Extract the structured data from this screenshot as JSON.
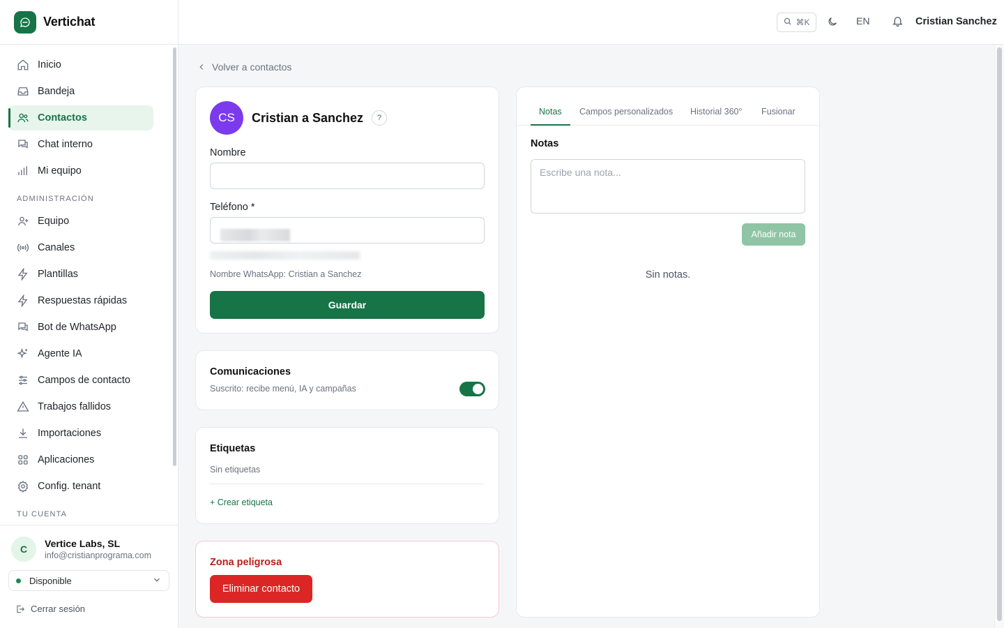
{
  "app": {
    "name": "Vertichat",
    "brand_color": "#167447"
  },
  "sidebar": {
    "items": [
      {
        "label": "Inicio",
        "icon": "home-icon",
        "active": false
      },
      {
        "label": "Bandeja",
        "icon": "inbox-icon",
        "active": false
      },
      {
        "label": "Contactos",
        "icon": "users-icon",
        "active": true
      },
      {
        "label": "Chat interno",
        "icon": "chat-icon",
        "active": false
      },
      {
        "label": "Mi equipo",
        "icon": "bar-chart-icon",
        "active": false
      }
    ],
    "admin_section": "ADMINISTRACIÓN",
    "admin_items": [
      {
        "label": "Equipo",
        "icon": "user-plus-icon"
      },
      {
        "label": "Canales",
        "icon": "radio-icon"
      },
      {
        "label": "Plantillas",
        "icon": "bolt-icon"
      },
      {
        "label": "Respuestas rápidas",
        "icon": "bolt-icon"
      },
      {
        "label": "Bot de WhatsApp",
        "icon": "chat-bot-icon"
      },
      {
        "label": "Agente IA",
        "icon": "sparkles-icon"
      },
      {
        "label": "Campos de contacto",
        "icon": "sliders-icon"
      },
      {
        "label": "Trabajos fallidos",
        "icon": "warning-icon"
      },
      {
        "label": "Importaciones",
        "icon": "download-icon"
      },
      {
        "label": "Aplicaciones",
        "icon": "apps-grid-icon"
      },
      {
        "label": "Config. tenant",
        "icon": "gear-icon"
      }
    ],
    "account_section": "TU CUENTA",
    "account": {
      "initial": "C",
      "org": "Vertice Labs, SL",
      "email": "info@cristianprograma.com"
    },
    "status": "Disponible",
    "logout": "Cerrar sesión"
  },
  "topbar": {
    "search_shortcut": "⌘K",
    "language": "EN",
    "user_name": "Cristian Sanchez"
  },
  "main": {
    "back_link": "Volver a contactos",
    "contact": {
      "initials": "CS",
      "name": "Cristian a Sanchez",
      "help": "?",
      "avatar_color": "#7c3aed"
    },
    "form": {
      "name_label": "Nombre",
      "name_value": "",
      "phone_label": "Teléfono *",
      "whatsapp_name": "Nombre WhatsApp: Cristian a Sanchez",
      "save_label": "Guardar"
    },
    "communications": {
      "title": "Comunicaciones",
      "subtitle": "Suscrito: recibe menú, IA y campañas",
      "subscribed": true
    },
    "tags": {
      "title": "Etiquetas",
      "empty": "Sin etiquetas",
      "create": "+ Crear etiqueta"
    },
    "danger": {
      "title": "Zona peligrosa",
      "delete_label": "Eliminar contacto"
    }
  },
  "right_panel": {
    "tabs": [
      {
        "label": "Notas",
        "active": true
      },
      {
        "label": "Campos personalizados",
        "active": false
      },
      {
        "label": "Historial 360°",
        "active": false
      },
      {
        "label": "Fusionar",
        "active": false
      }
    ],
    "notes_title": "Notas",
    "note_placeholder": "Escribe una nota...",
    "add_label": "Añadir nota",
    "empty": "Sin notas."
  }
}
